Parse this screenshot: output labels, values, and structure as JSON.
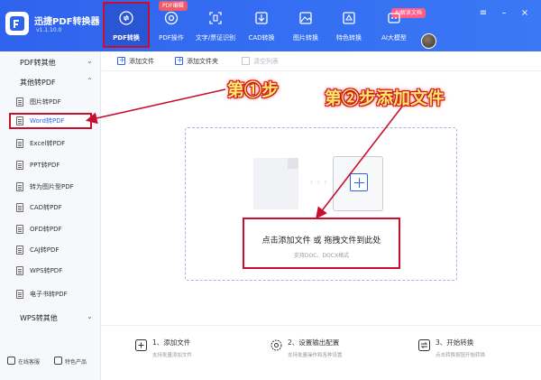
{
  "app": {
    "name": "迅捷PDF转换器",
    "version": "v1.1.10.0"
  },
  "nav": {
    "tabs": [
      {
        "label": "PDF转换",
        "icon": "pdf-convert-icon",
        "active": true
      },
      {
        "label": "PDF操作",
        "icon": "pdf-edit-icon"
      },
      {
        "label": "文字/票证识别",
        "icon": "ocr-scan-icon"
      },
      {
        "label": "CAD转换",
        "icon": "cad-icon"
      },
      {
        "label": "图片转换",
        "icon": "image-icon"
      },
      {
        "label": "特色转换",
        "icon": "special-convert-icon"
      },
      {
        "label": "AI大模型",
        "icon": "ai-model-icon"
      }
    ],
    "badges": {
      "pdf_edit": "PDF编辑",
      "ai": "AI解读文档"
    }
  },
  "sidebar": {
    "groups": [
      {
        "title": "PDF转其他",
        "expanded": false
      },
      {
        "title": "其他转PDF",
        "expanded": true
      },
      {
        "title": "WPS转其他",
        "expanded": false
      }
    ],
    "items": [
      {
        "label": "图片转PDF"
      },
      {
        "label": "Word转PDF",
        "selected": true
      },
      {
        "label": "Excel转PDF"
      },
      {
        "label": "PPT转PDF"
      },
      {
        "label": "转为图片型PDF"
      },
      {
        "label": "CAD转PDF"
      },
      {
        "label": "OFD转PDF"
      },
      {
        "label": "CAJ转PDF"
      },
      {
        "label": "WPS转PDF"
      },
      {
        "label": "电子书转PDF"
      }
    ],
    "footer": {
      "online_service": "在线客服",
      "featured_products": "特色产品"
    }
  },
  "toolbar": {
    "add_file": "添加文件",
    "add_folder": "添加文件夹",
    "clear_list": "清空列表"
  },
  "dropzone": {
    "hint": "点击添加文件 或 拖拽文件到此处",
    "support": "支持DOC、DOCX格式",
    "arrows": "› › ›"
  },
  "steps": [
    {
      "title": "1、添加文件",
      "desc": "支持批量添加文件",
      "icon": "add-file-icon"
    },
    {
      "title": "2、设置输出配置",
      "desc": "支持批量操作和各种设置",
      "icon": "settings-icon"
    },
    {
      "title": "3、开始转换",
      "desc": "点击转换按钮开始转换",
      "icon": "convert-icon"
    }
  ],
  "annotations": {
    "step1": "第①步",
    "step2": "第②步添加文件",
    "color": "#d0101c",
    "text_color": "#ffe96b"
  },
  "colors": {
    "brand_blue": "#2f63ee",
    "highlight_red": "#c8102e"
  }
}
